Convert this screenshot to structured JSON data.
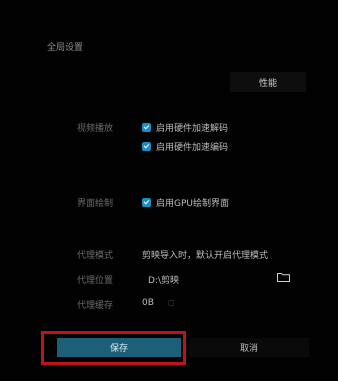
{
  "dialog": {
    "title": "全局设置",
    "performance_button": "性能"
  },
  "settings": {
    "video_label": "视频播放",
    "hw_decode_label": "启用硬件加速解码",
    "hw_encode_label": "启用硬件加速编码",
    "interface_label": "界面绘制",
    "gpu_render_label": "启用GPU绘制界面",
    "proxy_mode_label": "代理模式",
    "proxy_mode_value": "剪映导入时，默认开启代理模式",
    "proxy_location_label": "代理位置",
    "proxy_location_value": "D:\\剪映",
    "cache_label": "代理缓存",
    "cache_value": "0B"
  },
  "footer": {
    "save_label": "保存",
    "cancel_label": "取消"
  },
  "colors": {
    "accent": "#1a8fc0",
    "save_bg": "#1d5f78",
    "highlight": "#c0121c"
  }
}
